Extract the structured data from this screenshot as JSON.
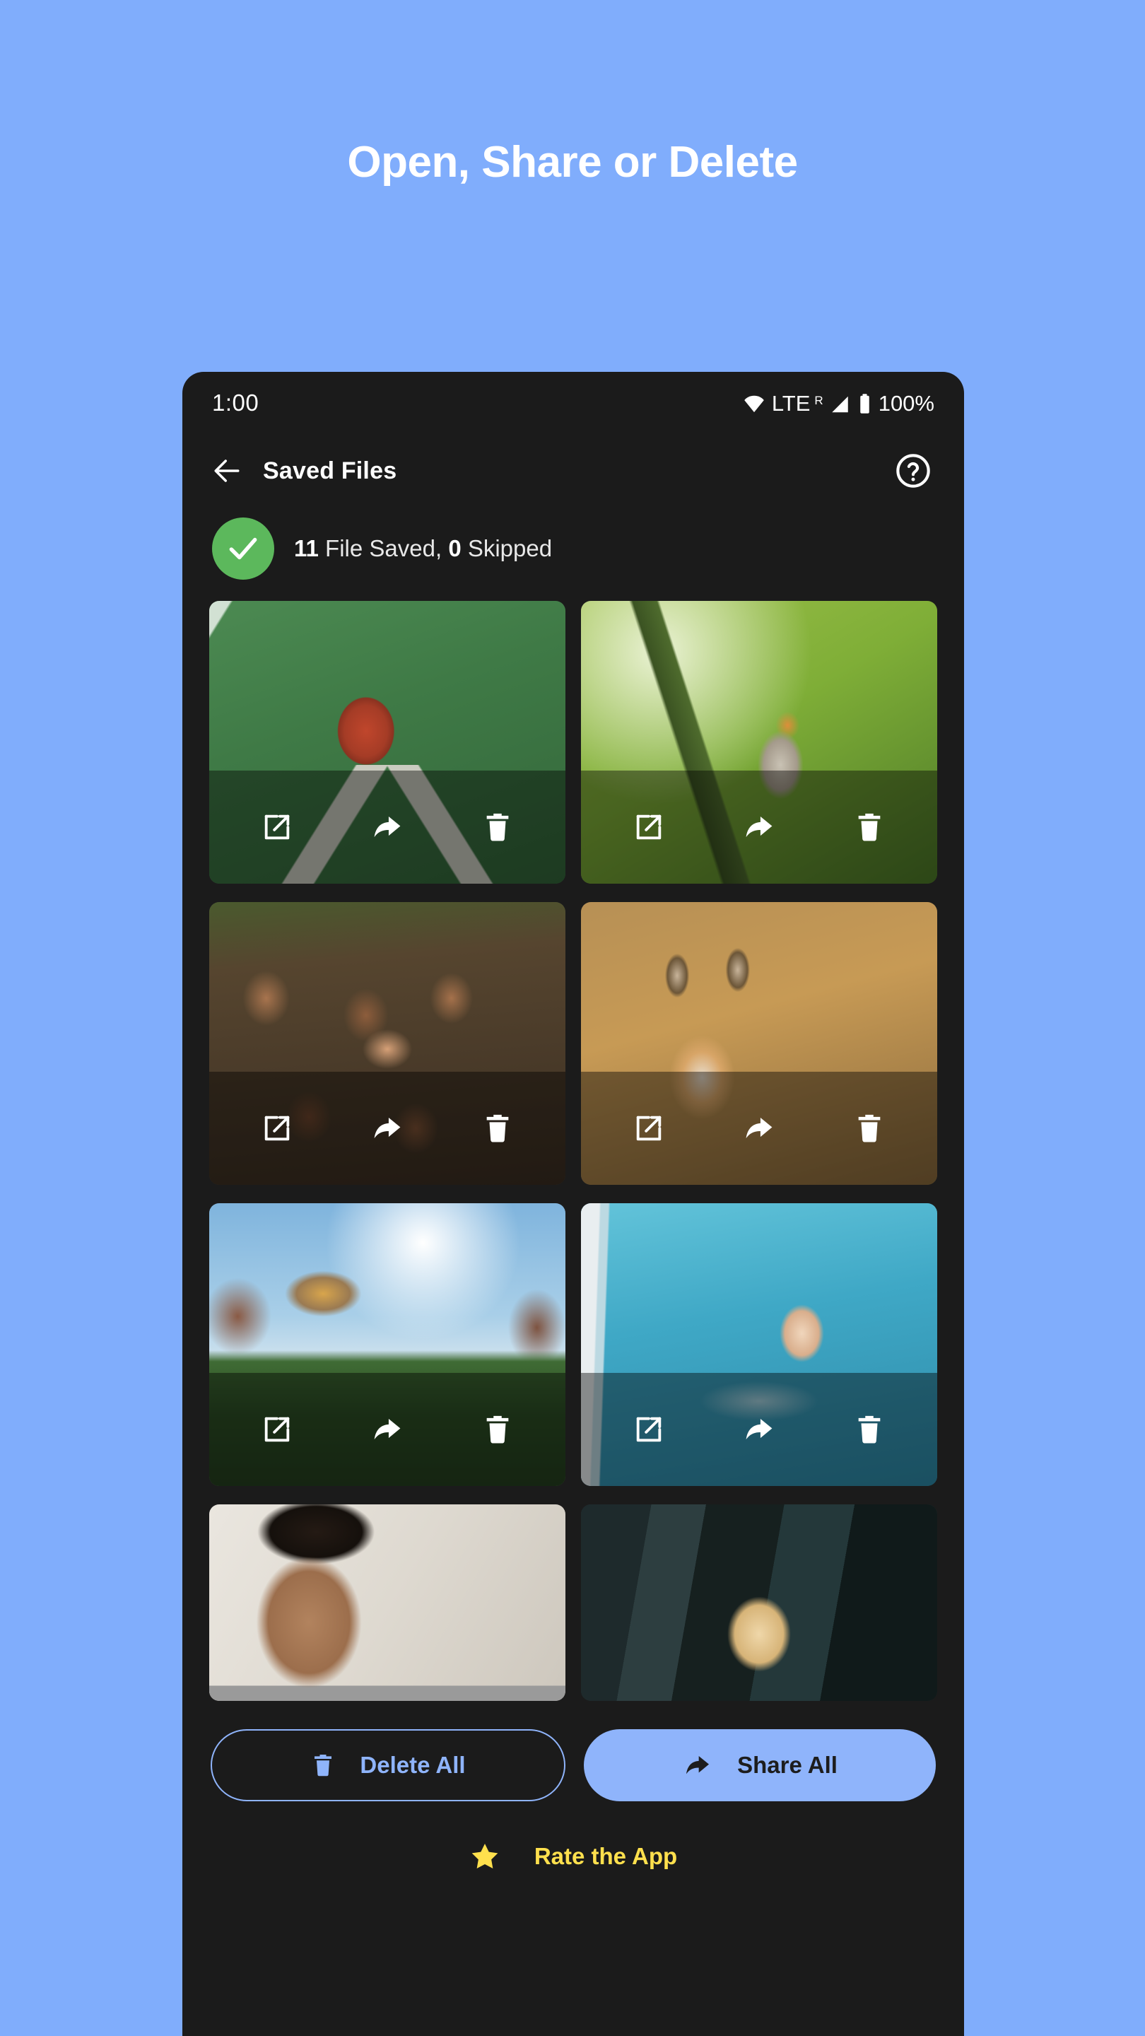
{
  "promo": {
    "headline": "Open, Share or Delete",
    "background_color": "#80ADFC"
  },
  "phone": {
    "status_bar": {
      "time": "1:00",
      "wifi_icon": "wifi-icon",
      "network": "LTE",
      "roaming": "R",
      "signal_icon": "signal-icon",
      "battery_icon": "battery-icon",
      "battery_percent": "100%"
    },
    "app_bar": {
      "back_icon": "back-arrow-icon",
      "title": "Saved Files",
      "help_icon": "help-circle-icon"
    },
    "summary": {
      "status_icon": "check-circle-icon",
      "saved_count": "11",
      "saved_label": " File Saved, ",
      "skipped_count": "0",
      "skipped_label": " Skipped",
      "badge_color": "#5CB85C"
    },
    "grid": {
      "action_labels": {
        "open": "open-external",
        "share": "share",
        "delete": "delete"
      },
      "tiles": [
        {
          "name": "basketball-on-green-court",
          "css": "ph-basketball",
          "has_actions": true,
          "short": false
        },
        {
          "name": "robin-bird-on-branch",
          "css": "ph-bird",
          "has_actions": true,
          "short": false
        },
        {
          "name": "group-of-children-smiling",
          "css": "ph-kids",
          "has_actions": true,
          "short": false
        },
        {
          "name": "red-fox-in-grass",
          "css": "ph-fox",
          "has_actions": true,
          "short": false
        },
        {
          "name": "canyon-mountain-landscape",
          "css": "ph-canyon",
          "has_actions": true,
          "short": false
        },
        {
          "name": "swimmer-in-pool",
          "css": "ph-swim",
          "has_actions": true,
          "short": false
        },
        {
          "name": "man-portrait",
          "css": "ph-man",
          "has_actions": false,
          "short": true
        },
        {
          "name": "golden-retriever-dog",
          "css": "ph-dog",
          "has_actions": false,
          "short": true
        }
      ]
    },
    "buttons": {
      "delete_all": {
        "label": "Delete All",
        "icon": "trash-icon",
        "color": "#8FB4FB"
      },
      "share_all": {
        "label": "Share All",
        "icon": "share-icon",
        "color": "#8FB4FB"
      }
    },
    "rate": {
      "icon": "star-icon",
      "label": "Rate the App",
      "color": "#FFE04D"
    }
  }
}
